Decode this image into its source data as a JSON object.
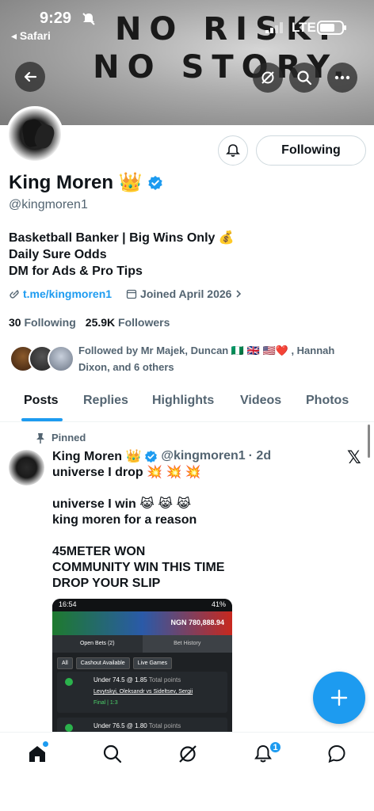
{
  "status_bar": {
    "time": "9:29",
    "back_app": "◂ Safari",
    "network": "LTE"
  },
  "banner": {
    "line1": "NO RISK.",
    "line2": "NO STORY."
  },
  "profile": {
    "name": "King Moren 👑",
    "handle": "@kingmoren1",
    "following_button": "Following",
    "bio": [
      "Basketball Banker | Big Wins Only 💰",
      "Daily Sure Odds",
      "DM for Ads & Pro Tips"
    ],
    "link": "t.me/kingmoren1",
    "joined": "Joined April 2026",
    "following_count": "30",
    "following_label": "Following",
    "followers_count": "25.9K",
    "followers_label": "Followers",
    "followed_by": "Followed by Mr Majek, Duncan 🇳🇬 🇬🇧 🇺🇸❤️ , Hannah Dixon, and 6 others"
  },
  "tabs": [
    "Posts",
    "Replies",
    "Highlights",
    "Videos",
    "Photos"
  ],
  "post": {
    "pinned_label": "Pinned",
    "name": "King Moren 👑",
    "handle": "@kingmoren1",
    "time": "· 2d",
    "lines": [
      "universe I drop 💥 💥 💥",
      "",
      "universe I win 😹 😹 😹",
      "king moren for a reason",
      "",
      "45METER WON",
      "COMMUNITY WIN THIS TIME",
      "DROP YOUR SLIP"
    ],
    "media": {
      "status_time": "16:54",
      "status_right": "41%",
      "balance": "NGN 780,888.94",
      "tab_open": "Open Bets (2)",
      "tab_history": "Bet History",
      "filters": [
        "All",
        "Cashout Available",
        "Live Games"
      ],
      "bets": [
        {
          "pick": "Under 74.5 @ 1.85",
          "market": "Total points",
          "match": "Levytskyi, Oleksandr vs Sideltsev, Sergii",
          "status": "Final | 1:3"
        },
        {
          "pick": "Under 76.5 @ 1.80",
          "market": "Total points",
          "match": "",
          "status": ""
        }
      ]
    }
  },
  "nav": {
    "notification_count": "1"
  },
  "colors": {
    "accent": "#1d9bf0",
    "text": "#0f1419",
    "muted": "#536471"
  }
}
